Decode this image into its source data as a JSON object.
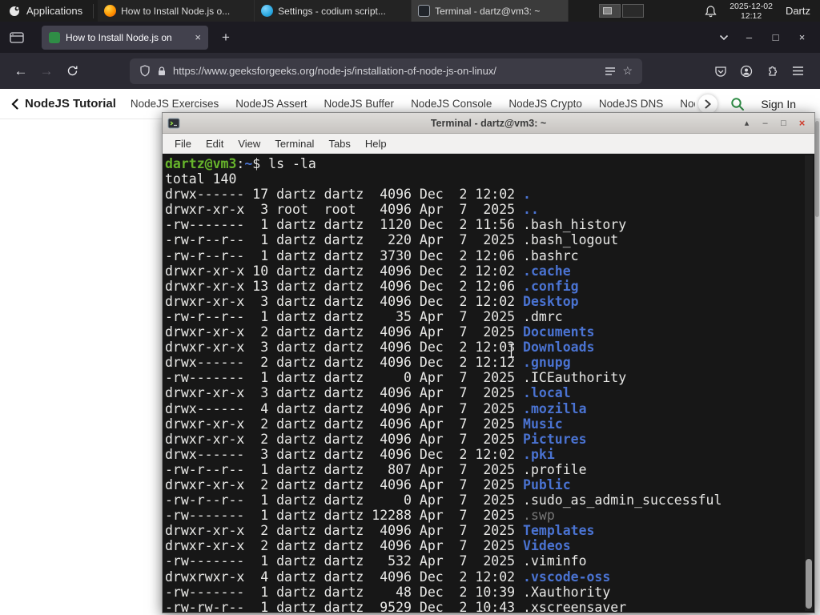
{
  "colors": {
    "dir_blue": "#4a73d2",
    "prompt_green": "#67b52b",
    "gfg_green": "#2f8d46",
    "close_red": "#cf3d2e"
  },
  "panel": {
    "applications_label": "Applications",
    "tasks": [
      {
        "title": "How to Install Node.js o...",
        "icon": "firefox",
        "active": false
      },
      {
        "title": "Settings - codium script...",
        "icon": "codium",
        "active": false
      },
      {
        "title": "Terminal - dartz@vm3: ~",
        "icon": "terminal",
        "active": true
      }
    ],
    "clock_date": "2025-12-02",
    "clock_time": "12:12",
    "user_label": "Dartz"
  },
  "browser": {
    "tab_title": "How to Install Node.js on",
    "url": "https://www.geeksforgeeks.org/node-js/installation-of-node-js-on-linux/",
    "glyphs": {
      "new_tab": "+",
      "tab_close": "×",
      "minimize": "–",
      "maximize": "□",
      "close": "×",
      "back": "←",
      "forward": "→",
      "bookmark_star": "☆"
    }
  },
  "site_nav": {
    "title": "NodeJS Tutorial",
    "links": [
      "NodeJS Exercises",
      "NodeJS Assert",
      "NodeJS Buffer",
      "NodeJS Console",
      "NodeJS Crypto",
      "NodeJS DNS",
      "Node"
    ],
    "sign_in_label": "Sign In"
  },
  "terminal": {
    "window_title": "Terminal - dartz@vm3: ~",
    "menu_items": [
      "File",
      "Edit",
      "View",
      "Terminal",
      "Tabs",
      "Help"
    ],
    "titlebar_glyphs": {
      "shade": "▴",
      "minimize": "–",
      "maximize": "□",
      "close": "×"
    },
    "prompt": {
      "user_host": "dartz@vm3",
      "separator": ":",
      "path": "~",
      "symbol": "$",
      "command": " ls -la"
    },
    "total_line": "total 140",
    "listing": [
      {
        "pre": "drwx------ 17 dartz dartz  4096 Dec  2 12:02 ",
        "name": ".",
        "type": "dir"
      },
      {
        "pre": "drwxr-xr-x  3 root  root   4096 Apr  7  2025 ",
        "name": "..",
        "type": "dir"
      },
      {
        "pre": "-rw-------  1 dartz dartz  1120 Dec  2 11:56 ",
        "name": ".bash_history",
        "type": "file"
      },
      {
        "pre": "-rw-r--r--  1 dartz dartz   220 Apr  7  2025 ",
        "name": ".bash_logout",
        "type": "file"
      },
      {
        "pre": "-rw-r--r--  1 dartz dartz  3730 Dec  2 12:06 ",
        "name": ".bashrc",
        "type": "file"
      },
      {
        "pre": "drwxr-xr-x 10 dartz dartz  4096 Dec  2 12:02 ",
        "name": ".cache",
        "type": "dir"
      },
      {
        "pre": "drwxr-xr-x 13 dartz dartz  4096 Dec  2 12:06 ",
        "name": ".config",
        "type": "dir"
      },
      {
        "pre": "drwxr-xr-x  3 dartz dartz  4096 Dec  2 12:02 ",
        "name": "Desktop",
        "type": "dir"
      },
      {
        "pre": "-rw-r--r--  1 dartz dartz    35 Apr  7  2025 ",
        "name": ".dmrc",
        "type": "file"
      },
      {
        "pre": "drwxr-xr-x  2 dartz dartz  4096 Apr  7  2025 ",
        "name": "Documents",
        "type": "dir"
      },
      {
        "pre": "drwxr-xr-x  3 dartz dartz  4096 Dec  2 12:03 ",
        "name": "Downloads",
        "type": "dir"
      },
      {
        "pre": "drwx------  2 dartz dartz  4096 Dec  2 12:12 ",
        "name": ".gnupg",
        "type": "dir"
      },
      {
        "pre": "-rw-------  1 dartz dartz     0 Apr  7  2025 ",
        "name": ".ICEauthority",
        "type": "file"
      },
      {
        "pre": "drwxr-xr-x  3 dartz dartz  4096 Apr  7  2025 ",
        "name": ".local",
        "type": "dir"
      },
      {
        "pre": "drwx------  4 dartz dartz  4096 Apr  7  2025 ",
        "name": ".mozilla",
        "type": "dir"
      },
      {
        "pre": "drwxr-xr-x  2 dartz dartz  4096 Apr  7  2025 ",
        "name": "Music",
        "type": "dir"
      },
      {
        "pre": "drwxr-xr-x  2 dartz dartz  4096 Apr  7  2025 ",
        "name": "Pictures",
        "type": "dir"
      },
      {
        "pre": "drwx------  3 dartz dartz  4096 Dec  2 12:02 ",
        "name": ".pki",
        "type": "dir"
      },
      {
        "pre": "-rw-r--r--  1 dartz dartz   807 Apr  7  2025 ",
        "name": ".profile",
        "type": "file"
      },
      {
        "pre": "drwxr-xr-x  2 dartz dartz  4096 Apr  7  2025 ",
        "name": "Public",
        "type": "dir"
      },
      {
        "pre": "-rw-r--r--  1 dartz dartz     0 Apr  7  2025 ",
        "name": ".sudo_as_admin_successful",
        "type": "file"
      },
      {
        "pre": "-rw-------  1 dartz dartz 12288 Apr  7  2025 ",
        "name": ".swp",
        "type": "dim"
      },
      {
        "pre": "drwxr-xr-x  2 dartz dartz  4096 Apr  7  2025 ",
        "name": "Templates",
        "type": "dir"
      },
      {
        "pre": "drwxr-xr-x  2 dartz dartz  4096 Apr  7  2025 ",
        "name": "Videos",
        "type": "dir"
      },
      {
        "pre": "-rw-------  1 dartz dartz   532 Apr  7  2025 ",
        "name": ".viminfo",
        "type": "file"
      },
      {
        "pre": "drwxrwxr-x  4 dartz dartz  4096 Dec  2 12:02 ",
        "name": ".vscode-oss",
        "type": "dir"
      },
      {
        "pre": "-rw-------  1 dartz dartz    48 Dec  2 10:39 ",
        "name": ".Xauthority",
        "type": "file"
      },
      {
        "pre": "-rw-rw-r--  1 dartz dartz  9529 Dec  2 10:43 ",
        "name": ".xscreensaver",
        "type": "file"
      }
    ]
  }
}
